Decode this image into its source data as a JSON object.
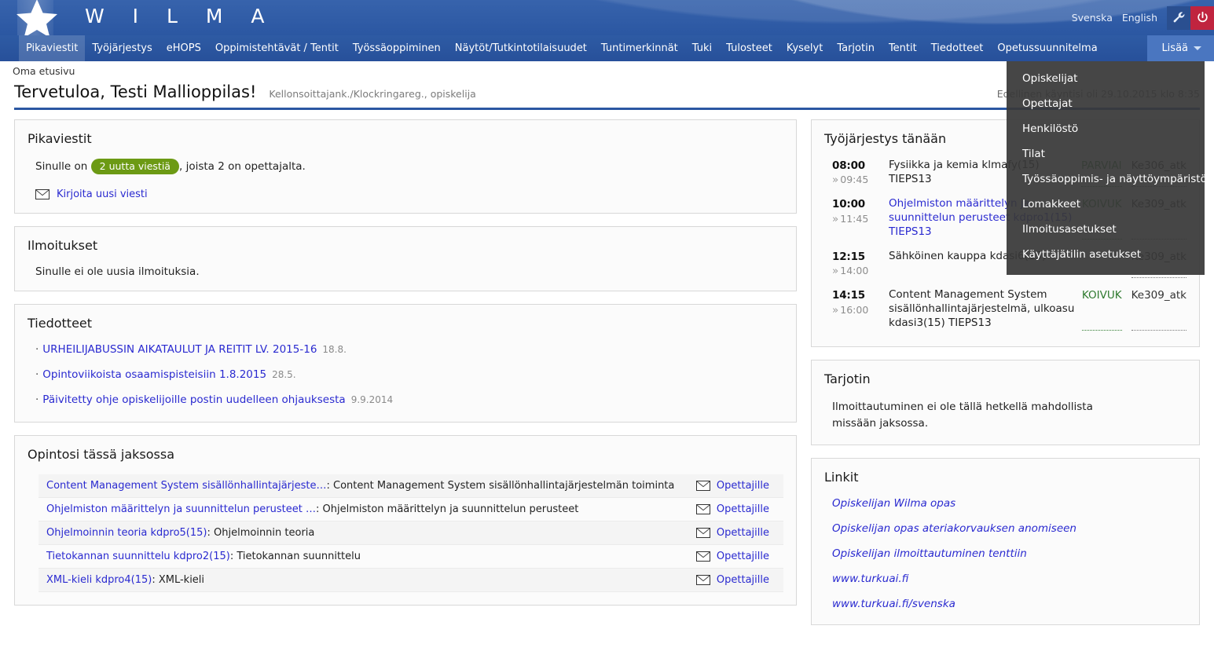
{
  "brand": {
    "wordmark": "W I L M A",
    "logo_icon": "star-logo",
    "lang_sv": "Svenska",
    "lang_en": "English",
    "wrench_icon": "wrench-icon",
    "power_icon": "power-icon",
    "bar_color": "#2b57a2",
    "power_color": "#c0243f"
  },
  "nav": {
    "items": [
      "Pikaviestit",
      "Työjärjestys",
      "eHOPS",
      "Oppimistehtävät / Tentit",
      "Työssäoppiminen",
      "Näytöt/Tutkintotilaisuudet",
      "Tuntimerkinnät",
      "Tuki",
      "Tulosteet",
      "Kyselyt",
      "Tarjotin",
      "Tentit",
      "Tiedotteet",
      "Opetussuunnitelma"
    ],
    "more_label": "Lisää"
  },
  "dropdown": {
    "items": [
      "Opiskelijat",
      "Opettajat",
      "Henkilöstö",
      "Tilat",
      "Työssäoppimis- ja näyttöympäristö",
      "Lomakkeet",
      "Ilmoitusasetukset",
      "Käyttäjätilin asetukset"
    ]
  },
  "header": {
    "breadcrumb": "Oma etusivu",
    "title": "Tervetuloa, Testi Mallioppilas!",
    "subtitle": "Kellonsoittajank./Klockringareg., opiskelija",
    "last_visit": "Edellinen käyntisi oli 29.10.2015 klo 8:35"
  },
  "messages": {
    "title": "Pikaviestit",
    "prefix": "Sinulle on",
    "badge": "2 uutta viestiä",
    "suffix": ", joista 2 on opettajalta.",
    "write_link": "Kirjoita uusi viesti",
    "badge_color": "#6c9a14"
  },
  "notices": {
    "title": "Ilmoitukset",
    "empty": "Sinulle ei ole uusia ilmoituksia."
  },
  "bulletins": {
    "title": "Tiedotteet",
    "items": [
      {
        "text": "URHEILIJABUSSIN AIKATAULUT JA REITIT LV. 2015-16",
        "date": "18.8."
      },
      {
        "text": "Opintoviikoista osaamispisteisiin 1.8.2015",
        "date": "28.5."
      },
      {
        "text": "Päivitetty ohje opiskelijoille postin uudelleen ohjauksesta",
        "date": "9.9.2014"
      }
    ]
  },
  "studies": {
    "title": "Opintosi tässä jaksossa",
    "action_label": "Opettajille",
    "rows": [
      {
        "name": "Content Management System sisällönhallintajärjeste…",
        "desc": "Content Management System sisällönhallintajärjestelmän toiminta"
      },
      {
        "name": "Ohjelmiston määrittelyn ja suunnittelun perusteet …",
        "desc": "Ohjelmiston määrittelyn ja suunnittelun perusteet"
      },
      {
        "name": "Ohjelmoinnin teoria kdpro5(15)",
        "desc": "Ohjelmoinnin teoria"
      },
      {
        "name": "Tietokannan suunnittelu kdpro2(15)",
        "desc": "Tietokannan suunnittelu"
      },
      {
        "name": "XML-kieli kdpro4(15)",
        "desc": "XML-kieli"
      }
    ]
  },
  "schedule": {
    "title": "Työjärjestys tänään",
    "rows": [
      {
        "start": "08:00",
        "end": "09:45",
        "subject": "Fysiikka ja kemia klmafy(15) TIEPS13",
        "teacher": "PARVIAI",
        "room": "Ke306_atk",
        "is_link": false
      },
      {
        "start": "10:00",
        "end": "11:45",
        "subject": "Ohjelmiston määrittelyn ja suunnittelun perusteet kdpro1(15) TIEPS13",
        "teacher": "KOIVUK",
        "room": "Ke309_atk",
        "is_link": true
      },
      {
        "start": "12:15",
        "end": "14:00",
        "subject": "Sähköinen kauppa kdasi6(15)",
        "teacher": "",
        "room": "Ke309_atk",
        "is_link": false
      },
      {
        "start": "14:15",
        "end": "16:00",
        "subject": "Content Management System sisällönhallintajärjestelmä, ulkoasu kdasi3(15) TIEPS13",
        "teacher": "KOIVUK",
        "room": "Ke309_atk",
        "is_link": false
      }
    ]
  },
  "offering": {
    "title": "Tarjotin",
    "text": "Ilmoittautuminen ei ole tällä hetkellä mahdollista missään jaksossa."
  },
  "links": {
    "title": "Linkit",
    "items": [
      "Opiskelijan Wilma opas",
      "Opiskelijan opas ateriakorvauksen anomiseen",
      "Opiskelijan ilmoittautuminen tenttiin",
      "www.turkuai.fi",
      "www.turkuai.fi/svenska"
    ]
  }
}
